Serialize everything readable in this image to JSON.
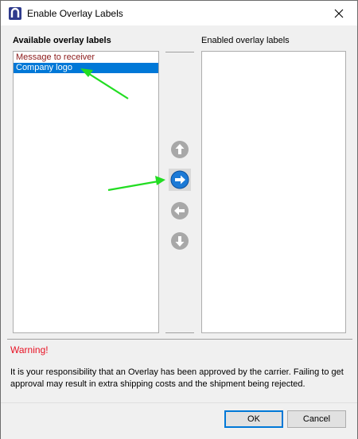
{
  "window": {
    "title": "Enable Overlay Labels",
    "app_icon": "app-logo-icon",
    "close_icon": "close-icon"
  },
  "available": {
    "label": "Available overlay labels",
    "items": [
      {
        "label": "Message to receiver",
        "selected": false
      },
      {
        "label": "Company logo",
        "selected": true
      }
    ]
  },
  "enabled": {
    "label": "Enabled overlay labels",
    "items": []
  },
  "move_buttons": [
    {
      "name": "move-up-icon",
      "enabled": false
    },
    {
      "name": "move-right-icon",
      "enabled": true
    },
    {
      "name": "move-left-icon",
      "enabled": false
    },
    {
      "name": "move-down-icon",
      "enabled": false
    }
  ],
  "warning": {
    "title": "Warning!",
    "text": "It is your responsibility that an Overlay has been approved by the carrier. Failing to get approval may result in extra shipping costs and the shipment being rejected."
  },
  "buttons": {
    "ok": "OK",
    "cancel": "Cancel"
  },
  "colors": {
    "selection": "#0078d7",
    "warning": "#e81123",
    "item_text": "#8b1a1a",
    "arrow_active": "#1c7ad6",
    "arrow_disabled": "#a8a8a8",
    "annotation_arrow": "#22dd22"
  }
}
